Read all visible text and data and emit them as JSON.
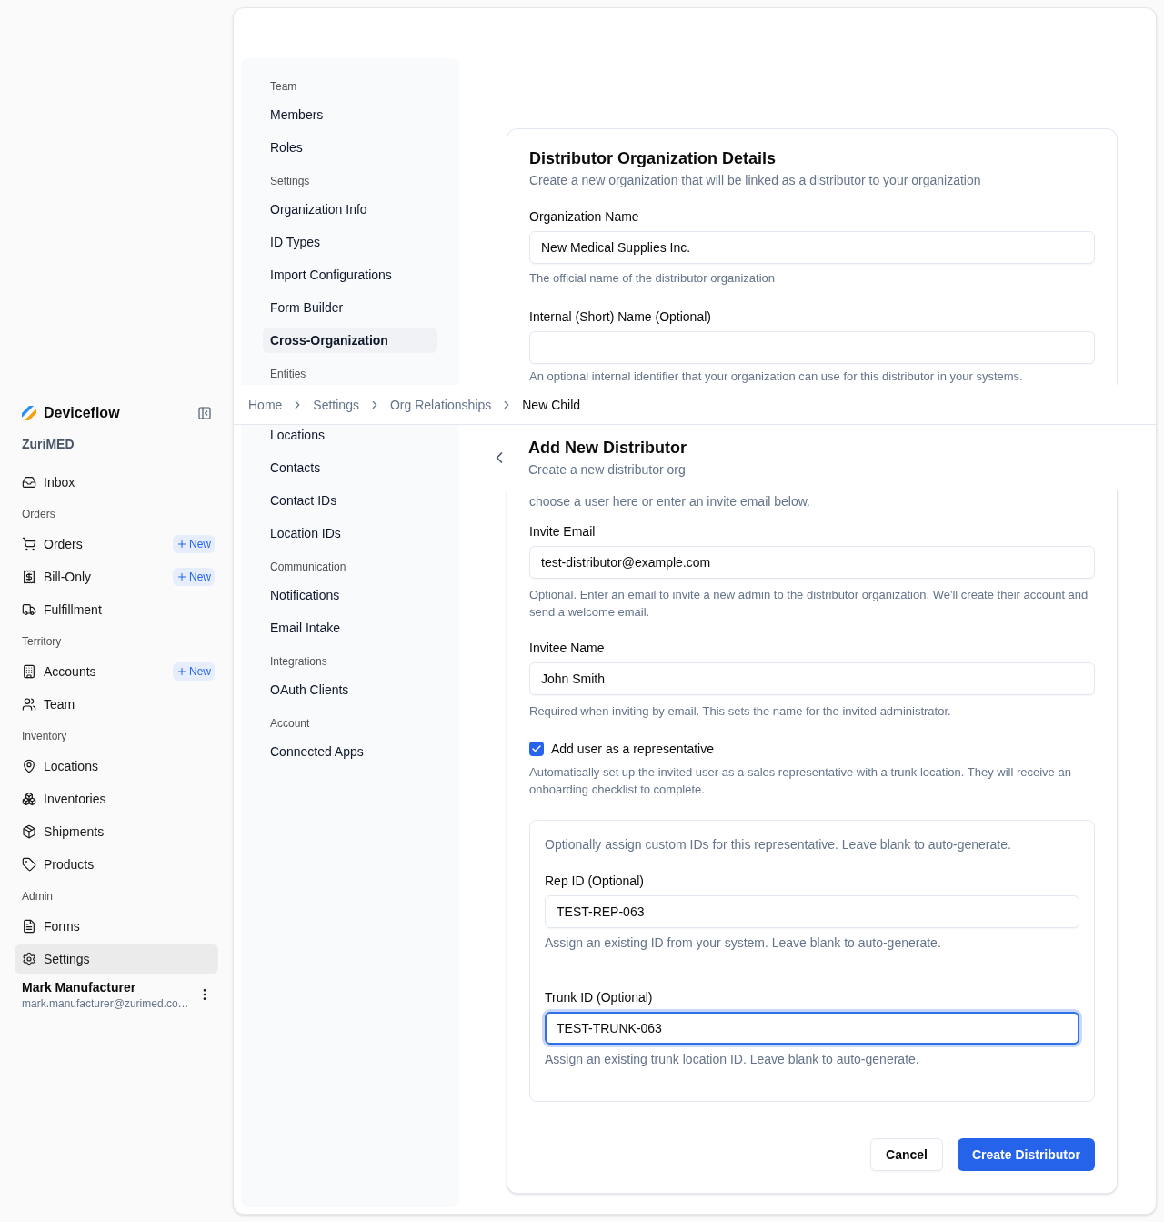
{
  "sidebar": {
    "brand": "Deviceflow",
    "org": "ZuriMED",
    "sections": [
      {
        "items": [
          {
            "label": "Inbox",
            "selected": false
          }
        ]
      },
      {
        "label": "Orders",
        "items": [
          {
            "label": "Orders",
            "badge": "New",
            "selected": false
          },
          {
            "label": "Bill-Only",
            "badge": "New",
            "selected": false
          },
          {
            "label": "Fulfillment",
            "selected": false
          }
        ]
      },
      {
        "label": "Territory",
        "items": [
          {
            "label": "Accounts",
            "badge": "New",
            "selected": false
          },
          {
            "label": "Team",
            "selected": false
          }
        ]
      },
      {
        "label": "Inventory",
        "items": [
          {
            "label": "Locations",
            "selected": false
          },
          {
            "label": "Inventories",
            "selected": false
          },
          {
            "label": "Shipments",
            "selected": false
          },
          {
            "label": "Products",
            "selected": false
          }
        ]
      },
      {
        "label": "Admin",
        "items": [
          {
            "label": "Forms",
            "selected": false
          },
          {
            "label": "Settings",
            "selected": true
          }
        ]
      }
    ],
    "user": {
      "name": "Mark Manufacturer",
      "email": "mark.manufacturer@zurimed.co…"
    }
  },
  "settings_nav": {
    "upper_groups": [
      {
        "label": "Team",
        "items": [
          {
            "label": "Members",
            "selected": false
          },
          {
            "label": "Roles",
            "selected": false
          }
        ]
      },
      {
        "label": "Settings",
        "items": [
          {
            "label": "Organization Info",
            "selected": false
          },
          {
            "label": "ID Types",
            "selected": false
          },
          {
            "label": "Import Configurations",
            "selected": false
          },
          {
            "label": "Form Builder",
            "selected": false
          },
          {
            "label": "Cross-Organization",
            "selected": true
          }
        ]
      },
      {
        "label": "Entities"
      }
    ],
    "lower_groups": [
      {
        "items": [
          {
            "label": "Locations",
            "selected": false
          },
          {
            "label": "Contacts",
            "selected": false
          },
          {
            "label": "Contact IDs",
            "selected": false
          },
          {
            "label": "Location IDs",
            "selected": false
          }
        ]
      },
      {
        "label": "Communication",
        "items": [
          {
            "label": "Notifications",
            "selected": false
          },
          {
            "label": "Email Intake",
            "selected": false
          }
        ]
      },
      {
        "label": "Integrations",
        "items": [
          {
            "label": "OAuth Clients",
            "selected": false
          }
        ]
      },
      {
        "label": "Account",
        "items": [
          {
            "label": "Connected Apps",
            "selected": false
          }
        ]
      }
    ]
  },
  "breadcrumb": [
    {
      "label": "Home",
      "current": false
    },
    {
      "label": "Settings",
      "current": false
    },
    {
      "label": "Org Relationships",
      "current": false
    },
    {
      "label": "New Child",
      "current": true
    }
  ],
  "page_header": {
    "title": "Add New Distributor",
    "subtitle": "Create a new distributor org"
  },
  "details_card": {
    "title": "Distributor Organization Details",
    "subtitle": "Create a new organization that will be linked as a distributor to your organization",
    "fields": [
      {
        "label": "Organization Name",
        "value": "New Medical Supplies Inc.",
        "help": "The official name of the distributor organization"
      },
      {
        "label": "Internal (Short) Name (Optional)",
        "help": "An optional internal identifier that your organization can use for this distributor in your systems."
      }
    ]
  },
  "form_card": {
    "intro": "choose a user here or enter an invite email below.",
    "fields": [
      {
        "label": "Invite Email",
        "value": "test-distributor@example.com",
        "help": "Optional. Enter an email to invite a new admin to the distributor organization. We'll create their account and send a welcome email."
      },
      {
        "label": "Invitee Name",
        "value": "John Smith",
        "help": "Required when inviting by email. This sets the name for the invited administrator."
      }
    ],
    "representative": {
      "label": "Add user as a representative",
      "checked": true,
      "help": "Automatically set up the invited user as a sales representative with a trunk location. They will receive an onboarding checklist to complete."
    },
    "ids_panel": {
      "intro": "Optionally assign custom IDs for this representative. Leave blank to auto-generate.",
      "fields": [
        {
          "label": "Rep ID (Optional)",
          "value": "TEST-REP-063",
          "help": "Assign an existing ID from your system. Leave blank to auto-generate.",
          "focused": false
        },
        {
          "label": "Trunk ID (Optional)",
          "value": "TEST-TRUNK-063",
          "help": "Assign an existing trunk location ID. Leave blank to auto-generate.",
          "focused": true
        }
      ]
    },
    "buttons": [
      {
        "label": "Cancel",
        "kind": "secondary"
      },
      {
        "label": "Create Distributor",
        "kind": "primary"
      }
    ]
  }
}
